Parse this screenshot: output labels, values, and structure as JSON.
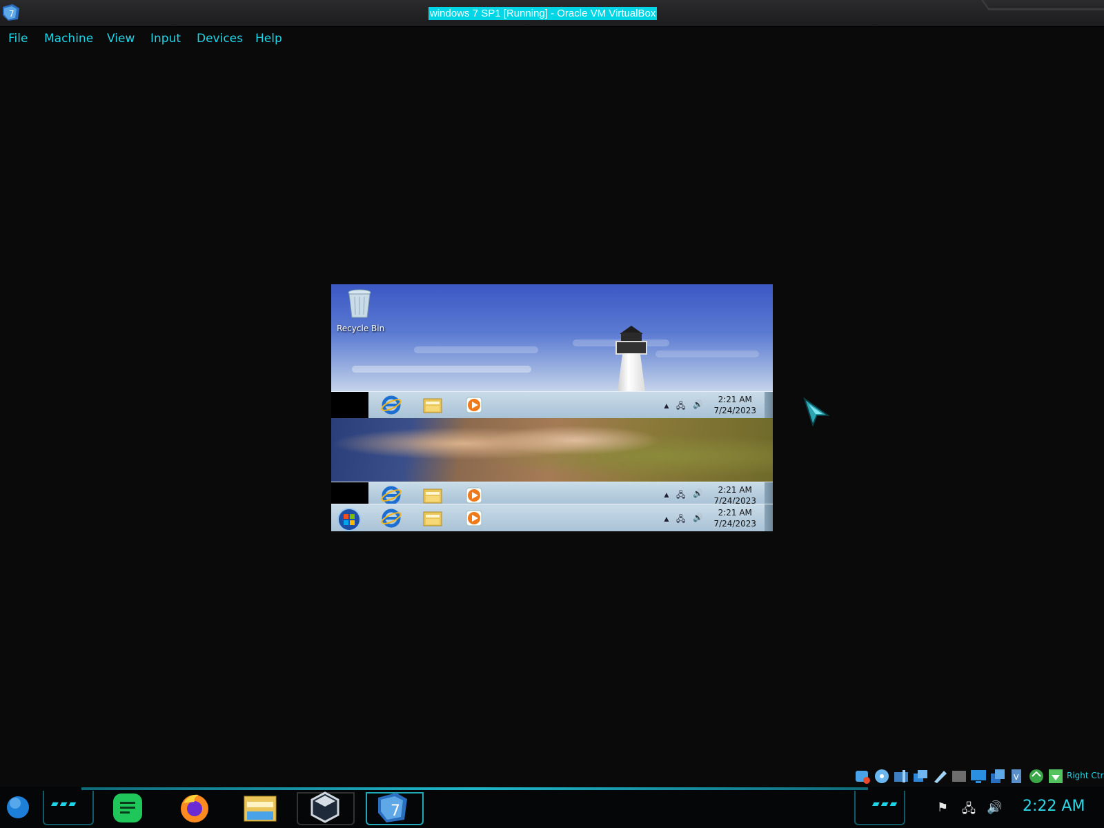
{
  "window": {
    "title": "windows 7 SP1 [Running] - Oracle VM VirtualBox",
    "app_icon": "virtualbox-vm-icon"
  },
  "menu": {
    "items": [
      {
        "label": "File"
      },
      {
        "label": "Machine"
      },
      {
        "label": "View"
      },
      {
        "label": "Input"
      },
      {
        "label": "Devices"
      },
      {
        "label": "Help"
      }
    ]
  },
  "guest": {
    "desktop_icons": [
      {
        "label": "Recycle Bin",
        "icon": "recycle-bin-icon"
      }
    ],
    "taskbars": [
      {
        "time": "2:21 AM",
        "date": "7/24/2023",
        "has_start_button": false
      },
      {
        "time": "2:21 AM",
        "date": "7/24/2023",
        "has_start_button": false
      },
      {
        "time": "2:21 AM",
        "date": "7/24/2023",
        "has_start_button": true
      }
    ],
    "pinned_apps": [
      "internet-explorer-icon",
      "windows-explorer-icon",
      "media-player-icon"
    ],
    "tray_icons": [
      "show-hidden-icons-arrow",
      "network-icon",
      "volume-icon"
    ]
  },
  "statusbar": {
    "host_key_label": "Right Ctrl",
    "icons": [
      "hard-disk-icon",
      "optical-drive-icon",
      "audio-icon",
      "network-icon",
      "usb-icon",
      "shared-folders-icon",
      "display-icon",
      "capture-icon",
      "vt-x-icon",
      "guest-additions-icon",
      "mouse-integration-icon"
    ]
  },
  "host_taskbar": {
    "start_icon": "start-orb-icon",
    "apps": [
      "notes-app-icon",
      "firefox-icon",
      "file-explorer-icon",
      "virtualbox-icon",
      "virtualbox-vm-icon"
    ],
    "tray": [
      "flag-icon",
      "network-icon",
      "volume-icon"
    ],
    "clock": "2:22 AM"
  },
  "colors": {
    "accent": "#1fd4e6",
    "title_highlight": "#00d6e6",
    "background": "#0a0a0a"
  }
}
